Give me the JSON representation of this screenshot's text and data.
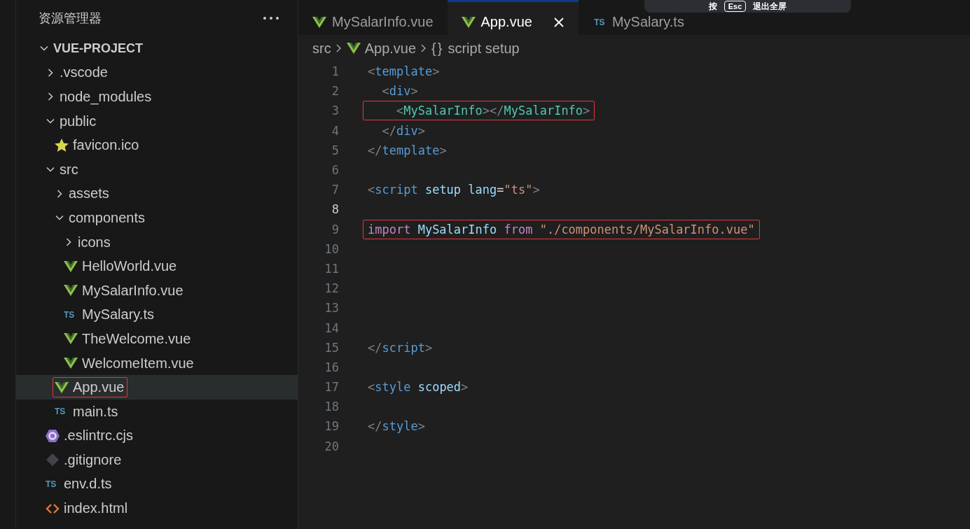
{
  "sidebar": {
    "title": "资源管理器",
    "tree": [
      {
        "label": "VUE-PROJECT",
        "kind": "root",
        "expanded": true,
        "children": [
          {
            "label": ".vscode",
            "kind": "folder",
            "expanded": false
          },
          {
            "label": "node_modules",
            "kind": "folder",
            "expanded": false
          },
          {
            "label": "public",
            "kind": "folder",
            "expanded": true,
            "children": [
              {
                "label": "favicon.ico",
                "kind": "star"
              }
            ]
          },
          {
            "label": "src",
            "kind": "folder",
            "expanded": true,
            "children": [
              {
                "label": "assets",
                "kind": "folder",
                "expanded": false
              },
              {
                "label": "components",
                "kind": "folder",
                "expanded": true,
                "children": [
                  {
                    "label": "icons",
                    "kind": "folder",
                    "expanded": false
                  },
                  {
                    "label": "HelloWorld.vue",
                    "kind": "vue"
                  },
                  {
                    "label": "MySalarInfo.vue",
                    "kind": "vue"
                  },
                  {
                    "label": "MySalary.ts",
                    "kind": "ts",
                    "badge": "TS"
                  },
                  {
                    "label": "TheWelcome.vue",
                    "kind": "vue"
                  },
                  {
                    "label": "WelcomeItem.vue",
                    "kind": "vue"
                  }
                ]
              },
              {
                "label": "App.vue",
                "kind": "vue",
                "selected": true,
                "highlighted": true
              },
              {
                "label": "main.ts",
                "kind": "ts",
                "badge": "TS"
              }
            ]
          },
          {
            "label": ".eslintrc.cjs",
            "kind": "eslint"
          },
          {
            "label": ".gitignore",
            "kind": "git"
          },
          {
            "label": "env.d.ts",
            "kind": "ts",
            "badge": "TS"
          },
          {
            "label": "index.html",
            "kind": "html"
          }
        ]
      }
    ]
  },
  "tabs": [
    {
      "label": "MySalarInfo.vue",
      "kind": "vue",
      "selected": false
    },
    {
      "label": "App.vue",
      "kind": "vue",
      "selected": true
    },
    {
      "label": "MySalary.ts",
      "kind": "ts",
      "badge": "TS",
      "selected": false
    }
  ],
  "breadcrumb": [
    {
      "label": "src",
      "kind": "folder"
    },
    {
      "label": "App.vue",
      "kind": "vue"
    },
    {
      "label": "script setup",
      "kind": "symbol",
      "symbol": "{}"
    }
  ],
  "toast": {
    "prefix": "按",
    "key": "Esc",
    "suffix": "退出全屏"
  },
  "code": {
    "lines": [
      {
        "number": "1",
        "tokens": [
          {
            "text": "<",
            "kind": "punct"
          },
          {
            "text": "template",
            "kind": "tag"
          },
          {
            "text": ">",
            "kind": "punct"
          }
        ]
      },
      {
        "number": "2",
        "tokens": [
          {
            "text": "  <",
            "kind": "punct"
          },
          {
            "text": "div",
            "kind": "tag"
          },
          {
            "text": ">",
            "kind": "punct"
          }
        ]
      },
      {
        "number": "3",
        "highlighted": true,
        "tokens": [
          {
            "text": "    <",
            "kind": "punct"
          },
          {
            "text": "MySalarInfo",
            "kind": "component"
          },
          {
            "text": "></",
            "kind": "punct"
          },
          {
            "text": "MySalarInfo",
            "kind": "component"
          },
          {
            "text": ">",
            "kind": "punct"
          }
        ]
      },
      {
        "number": "4",
        "tokens": [
          {
            "text": "  </",
            "kind": "punct"
          },
          {
            "text": "div",
            "kind": "tag"
          },
          {
            "text": ">",
            "kind": "punct"
          }
        ]
      },
      {
        "number": "5",
        "tokens": [
          {
            "text": "</",
            "kind": "punct"
          },
          {
            "text": "template",
            "kind": "tag"
          },
          {
            "text": ">",
            "kind": "punct"
          }
        ]
      },
      {
        "number": "6"
      },
      {
        "number": "7",
        "tokens": [
          {
            "text": "<",
            "kind": "punct"
          },
          {
            "text": "script",
            "kind": "tag"
          },
          {
            "text": " setup lang",
            "kind": "attr"
          },
          {
            "text": "=",
            "kind": "plain"
          },
          {
            "text": "\"ts\"",
            "kind": "string"
          },
          {
            "text": ">",
            "kind": "punct"
          }
        ]
      },
      {
        "number": "8",
        "current": true
      },
      {
        "number": "9",
        "highlighted": true,
        "tokens": [
          {
            "text": "import",
            "kind": "keyword"
          },
          {
            "text": " MySalarInfo ",
            "kind": "ident"
          },
          {
            "text": "from",
            "kind": "keyword"
          },
          {
            "text": " \"./components/MySalarInfo.vue\"",
            "kind": "string"
          }
        ]
      },
      {
        "number": "10"
      },
      {
        "number": "11"
      },
      {
        "number": "12"
      },
      {
        "number": "13"
      },
      {
        "number": "14"
      },
      {
        "number": "15",
        "tokens": [
          {
            "text": "</",
            "kind": "punct"
          },
          {
            "text": "script",
            "kind": "tag"
          },
          {
            "text": ">",
            "kind": "punct"
          }
        ]
      },
      {
        "number": "16"
      },
      {
        "number": "17",
        "tokens": [
          {
            "text": "<",
            "kind": "punct"
          },
          {
            "text": "style",
            "kind": "tag"
          },
          {
            "text": " scoped",
            "kind": "attr"
          },
          {
            "text": ">",
            "kind": "punct"
          }
        ]
      },
      {
        "number": "18"
      },
      {
        "number": "19",
        "tokens": [
          {
            "text": "</",
            "kind": "punct"
          },
          {
            "text": "style",
            "kind": "tag"
          },
          {
            "text": ">",
            "kind": "punct"
          }
        ]
      },
      {
        "number": "20"
      }
    ]
  }
}
